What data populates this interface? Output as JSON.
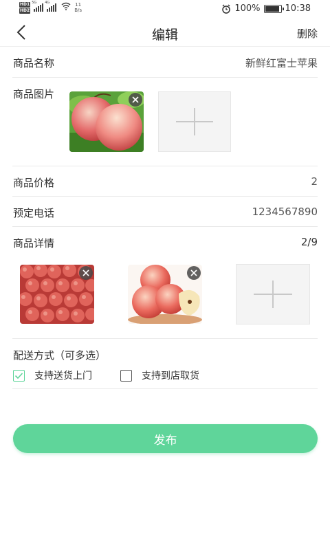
{
  "status_bar": {
    "hd1": "HD1",
    "hd2": "HD2",
    "net1": "5G",
    "net2": "4G",
    "speed_value": "11",
    "speed_unit": "B/s",
    "battery": "100%",
    "time": "10:38"
  },
  "header": {
    "title": "编辑",
    "delete_label": "删除"
  },
  "form": {
    "name_label": "商品名称",
    "name_value": "新鲜红富士苹果",
    "image_label": "商品图片",
    "price_label": "商品价格",
    "price_value": "2",
    "phone_label": "预定电话",
    "phone_value": "1234567890",
    "detail_label": "商品详情",
    "detail_count": "2/9"
  },
  "delivery": {
    "title": "配送方式（可多选）",
    "options": [
      {
        "label": "支持送货上门",
        "checked": true
      },
      {
        "label": "支持到店取货",
        "checked": false
      }
    ]
  },
  "publish_label": "发布",
  "colors": {
    "accent": "#5fd59a"
  }
}
